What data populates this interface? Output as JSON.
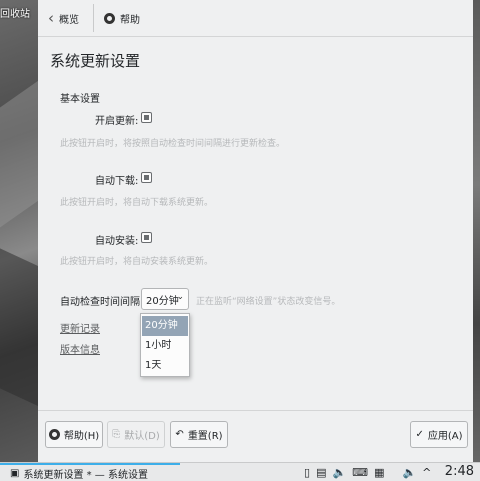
{
  "desktop": {
    "label": "回收站"
  },
  "toolbar": {
    "back_label": "概览",
    "help_label": "帮助"
  },
  "page": {
    "title": "系统更新设置"
  },
  "basic": {
    "section_title": "基本设置",
    "enable_updates": {
      "label": "开启更新:",
      "checked": true,
      "hint": "此按钮开启时，将按照自动检查时间间隔进行更新检查。"
    },
    "auto_download": {
      "label": "自动下载:",
      "checked": true,
      "hint": "此按钮开启时，将自动下载系统更新。"
    },
    "auto_install": {
      "label": "自动安装:",
      "checked": true,
      "hint": "此按钮开启时，将自动安装系统更新。"
    },
    "interval": {
      "label": "自动检查时间间隔:",
      "value": "20分钟",
      "hint": "正在监听“网络设置”状态改变信号。",
      "options": [
        "20分钟",
        "1小时",
        "1天"
      ]
    }
  },
  "links": {
    "changelog": "更新记录",
    "version_info": "版本信息"
  },
  "buttons": {
    "help": "帮助(H)",
    "default": "默认(D)",
    "reset": "重置(R)",
    "apply": "应用(A)"
  },
  "taskbar": {
    "task_title": "系统更新设置 * — 系统设置",
    "clock": "2:48"
  },
  "colors": {
    "accent": "#3daee9",
    "selected_option": "#93a4b5",
    "hint_text": "#b6b8ba"
  }
}
